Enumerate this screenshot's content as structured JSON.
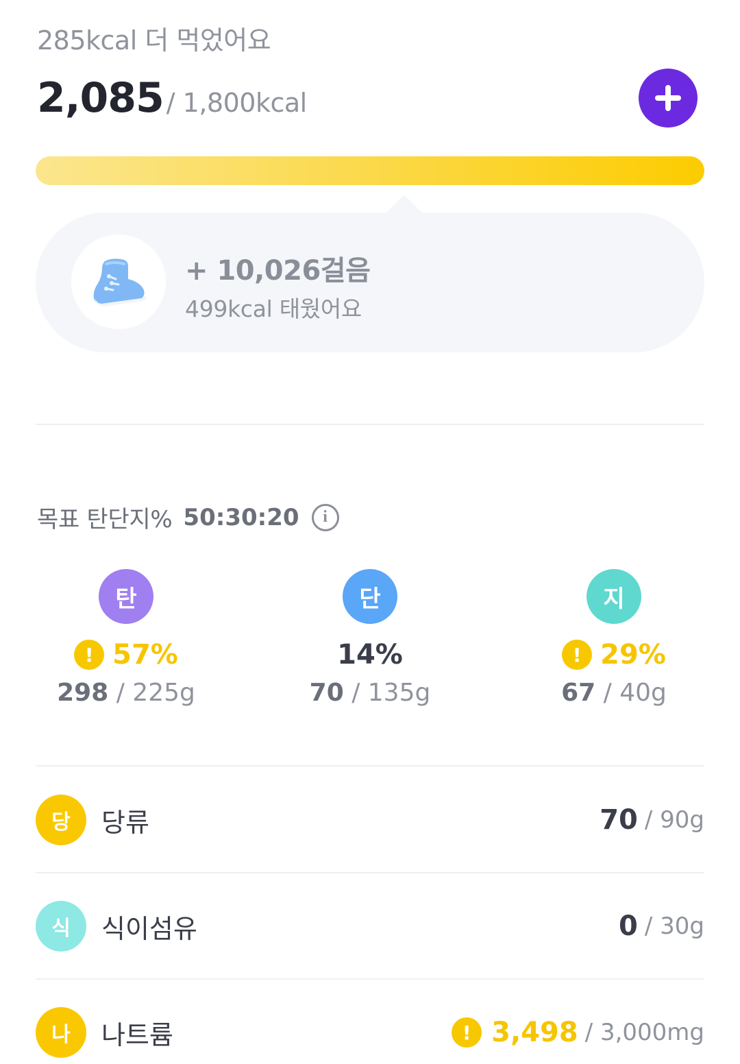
{
  "summary": {
    "over_text": "285kcal 더 먹었어요",
    "eaten_kcal": "2,085",
    "goal_kcal": "/ 1,800kcal",
    "progress": 1.0,
    "colors": {
      "accent": "#6c2ae0",
      "progress_start": "#fbe68e",
      "progress_end": "#fccc00"
    }
  },
  "activity": {
    "icon": "sneaker-icon",
    "steps": "+ 10,026걸음",
    "burned": "499kcal 태웠어요"
  },
  "ratio": {
    "label": "목표 탄단지%",
    "value": "50:30:20",
    "info_glyph": "i"
  },
  "macros": [
    {
      "badge": "탄",
      "color": "#a07ff0",
      "warn": true,
      "percent": "57%",
      "current": "298",
      "goal": " / 225g"
    },
    {
      "badge": "단",
      "color": "#5aa6f7",
      "warn": false,
      "percent": "14%",
      "current": "70",
      "goal": " / 135g"
    },
    {
      "badge": "지",
      "color": "#5fd8d0",
      "warn": true,
      "percent": "29%",
      "current": "67",
      "goal": " / 40g"
    }
  ],
  "nutrients": [
    {
      "badge": "당",
      "color": "#fac800",
      "name": "당류",
      "warn": false,
      "current": "70",
      "goal": "/ 90g"
    },
    {
      "badge": "식",
      "color": "#8ee8e4",
      "name": "식이섬유",
      "warn": false,
      "current": "0",
      "goal": "/ 30g"
    },
    {
      "badge": "나",
      "color": "#fac800",
      "name": "나트륨",
      "warn": true,
      "current": "3,498",
      "goal": "/ 3,000mg"
    }
  ],
  "warn_glyph": "!"
}
